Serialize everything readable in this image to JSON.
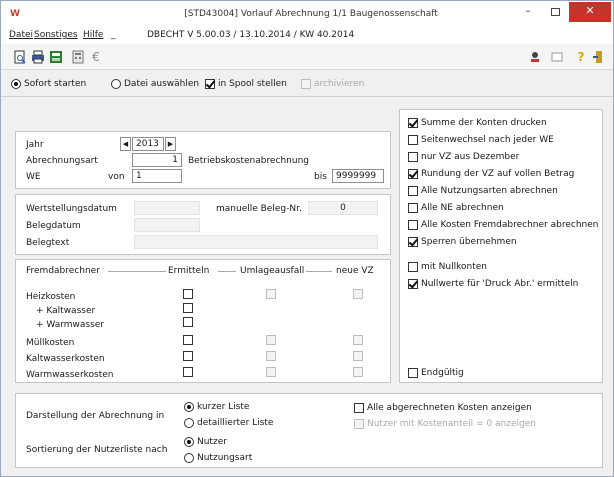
{
  "window": {
    "app_icon_letter": "W",
    "title": "[STD43004] Vorlauf Abrechnung  1/1 Baugenossenschaft",
    "minimize": "–",
    "close": "✕"
  },
  "menu": {
    "items": [
      "Datei",
      "Sonstiges",
      "Hilfe",
      "_"
    ],
    "version_info": "DBECHT V 5.00.03  /  13.10.2014  /  KW 40.2014"
  },
  "toolbar": {
    "icons": [
      "print-preview-icon",
      "print-icon",
      "spool-icon",
      "calculator-icon",
      "euro-icon"
    ],
    "euro": "€",
    "right_icons": [
      "user-icon",
      "folder-icon",
      "help-icon",
      "exit-icon"
    ]
  },
  "options": {
    "sofort_starten": "Sofort starten",
    "datei_auswaehlen": "Datei auswählen",
    "in_spool_stellen": "in Spool stellen",
    "archivieren": "archivieren"
  },
  "selection": {
    "jahr_label": "Jahr",
    "jahr_value": "2013",
    "abrechnungsart_label": "Abrechnungsart",
    "abrechnungsart_value": "1",
    "abrechnungsart_text": "Betriebskostenabrechnung",
    "we_label": "WE",
    "von_label": "von",
    "von_value": "1",
    "bis_label": "bis",
    "bis_value": "9999999"
  },
  "beleg": {
    "wertstellungsdatum_label": "Wertstellungsdatum",
    "manuelle_beleg_label": "manuelle Beleg-Nr.",
    "manuelle_beleg_value": "0",
    "belegdatum_label": "Belegdatum",
    "belegtext_label": "Belegtext"
  },
  "fremd": {
    "header_fremdabrechner": "Fremdabrechner",
    "header_ermitteln": "Ermitteln",
    "header_umlageausfall": "Umlageausfall",
    "header_neue_vz": "neue VZ",
    "rows": [
      {
        "label": "Heizkosten"
      },
      {
        "label": "+ Kaltwasser"
      },
      {
        "label": "+ Warmwasser"
      },
      {
        "label": "Müllkosten"
      },
      {
        "label": "Kaltwasserkosten"
      },
      {
        "label": "Warmwasserkosten"
      }
    ]
  },
  "right_options": [
    {
      "label": "Summe der Konten drucken",
      "checked": true
    },
    {
      "label": "Seitenwechsel nach jeder WE",
      "checked": false
    },
    {
      "label": "nur VZ aus Dezember",
      "checked": false
    },
    {
      "label": "Rundung der VZ auf vollen Betrag",
      "checked": true
    },
    {
      "label": "Alle Nutzungsarten abrechnen",
      "checked": false
    },
    {
      "label": "Alle NE abrechnen",
      "checked": false
    },
    {
      "label": "Alle Kosten Fremdabrechner abrechnen",
      "checked": false
    },
    {
      "label": "Sperren übernehmen",
      "checked": true
    }
  ],
  "right_options2": [
    {
      "label": "mit Nullkonten",
      "checked": false
    },
    {
      "label": "Nullwerte für 'Druck Abr.' ermitteln",
      "checked": true
    }
  ],
  "endgueltig": "Endgültig",
  "darstellung": {
    "label": "Darstellung der Abrechnung in",
    "kurzer_liste": "kurzer Liste",
    "detaillierter_liste": "detaillierter Liste",
    "alle_kosten": "Alle abgerechneten Kosten anzeigen",
    "nutzer_kostenanteil": "Nutzer mit Kostenanteil = 0 anzeigen"
  },
  "sortierung": {
    "label": "Sortierung der Nutzerliste nach",
    "nutzer": "Nutzer",
    "nutzungsart": "Nutzungsart"
  }
}
